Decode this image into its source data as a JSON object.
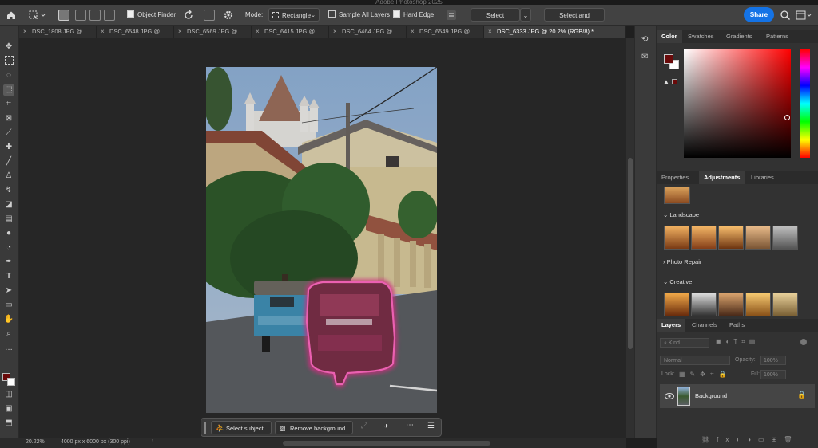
{
  "window": {
    "title": "Adobe Photoshop 2025"
  },
  "options_bar": {
    "object_finder_label": "Object Finder",
    "mode_label": "Mode:",
    "mode_value": "Rectangle",
    "sample_all_layers_label": "Sample All Layers",
    "hard_edge_label": "Hard Edge",
    "select_subject_label": "Select Subject",
    "select_and_mask_label": "Select and Mask...",
    "share_label": "Share"
  },
  "document_tabs": [
    {
      "label": "DSC_1808.JPG @ ..."
    },
    {
      "label": "DSC_6548.JPG @ ..."
    },
    {
      "label": "DSC_6569.JPG @ ..."
    },
    {
      "label": "DSC_6415.JPG @ ..."
    },
    {
      "label": "DSC_6464.JPG @ ..."
    },
    {
      "label": "DSC_6549.JPG @ ..."
    },
    {
      "label": "DSC_6333.JPG @ 20.2% (RGB/8) *"
    }
  ],
  "contextual_bar": {
    "select_subject_label": "Select subject",
    "remove_background_label": "Remove background"
  },
  "status_bar": {
    "zoom": "20.22%",
    "doc_info": "4000 px x 6000 px (300 ppi)"
  },
  "color_panel": {
    "tabs": [
      "Color",
      "Swatches",
      "Gradients",
      "Patterns"
    ],
    "foreground_color": "#6a0a0a",
    "background_color": "#ffffff"
  },
  "adjustments_panel": {
    "tabs": [
      "Properties",
      "Adjustments",
      "Libraries"
    ],
    "sections": [
      {
        "label": "Landscape",
        "expanded": true
      },
      {
        "label": "Photo Repair",
        "expanded": false
      },
      {
        "label": "Creative",
        "expanded": true
      }
    ]
  },
  "layers_panel": {
    "tabs": [
      "Layers",
      "Channels",
      "Paths"
    ],
    "kind_label": "Kind",
    "blend_mode": "Normal",
    "opacity_label": "Opacity:",
    "opacity_value": "100%",
    "lock_label": "Lock:",
    "fill_label": "Fill:",
    "fill_value": "100%",
    "layers": [
      {
        "name": "Background",
        "locked": true
      }
    ]
  },
  "accent_color": "#1473e6",
  "selection_overlay_color": "#e0338a"
}
